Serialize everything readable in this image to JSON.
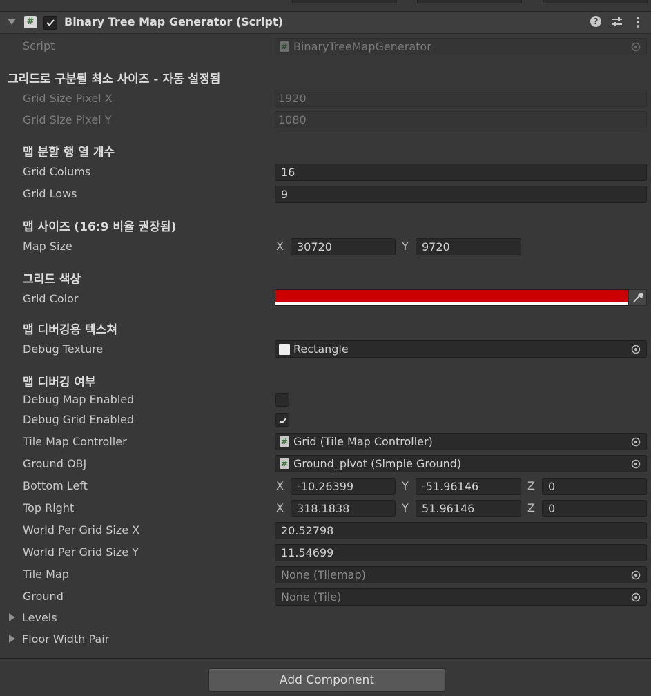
{
  "component": {
    "title": "Binary Tree Map Generator (Script)",
    "script_icon": "#",
    "help_glyph": "?",
    "enabled": true
  },
  "script": {
    "label": "Script",
    "value": "BinaryTreeMapGenerator"
  },
  "sections": {
    "grid_min": "그리드로 구분될 최소 사이즈 - 자동 설정됨",
    "split": "맵 분할 행 열 개수",
    "map_size": "맵 사이즈 (16:9 비율 권장됨)",
    "grid_color": "그리드 색상",
    "debug_texture": "맵 디버깅용 텍스쳐",
    "debug_enabled": "맵 디버깅 여부"
  },
  "fields": {
    "grid_size_pixel_x": {
      "label": "Grid Size Pixel X",
      "value": "1920"
    },
    "grid_size_pixel_y": {
      "label": "Grid Size Pixel Y",
      "value": "1080"
    },
    "grid_colums": {
      "label": "Grid Colums",
      "value": "16"
    },
    "grid_lows": {
      "label": "Grid Lows",
      "value": "9"
    },
    "map_size": {
      "label": "Map Size",
      "x": "30720",
      "y": "9720"
    },
    "grid_color": {
      "label": "Grid Color",
      "color": "#cc0000"
    },
    "debug_texture": {
      "label": "Debug Texture",
      "value": "Rectangle"
    },
    "debug_map_enabled": {
      "label": "Debug Map Enabled",
      "checked": false
    },
    "debug_grid_enabled": {
      "label": "Debug Grid Enabled",
      "checked": true
    },
    "tile_map_controller": {
      "label": "Tile Map Controller",
      "value": "Grid (Tile Map Controller)"
    },
    "ground_obj": {
      "label": "Ground OBJ",
      "value": "Ground_pivot (Simple Ground)"
    },
    "bottom_left": {
      "label": "Bottom Left",
      "x": "-10.26399",
      "y": "-51.96146",
      "z": "0"
    },
    "top_right": {
      "label": "Top Right",
      "x": "318.1838",
      "y": "51.96146",
      "z": "0"
    },
    "world_per_grid_size_x": {
      "label": "World Per Grid Size X",
      "value": "20.52798"
    },
    "world_per_grid_size_y": {
      "label": "World Per Grid Size Y",
      "value": "11.54699"
    },
    "tile_map": {
      "label": "Tile Map",
      "value": "None (Tilemap)"
    },
    "ground": {
      "label": "Ground",
      "value": "None (Tile)"
    }
  },
  "axes": {
    "x": "X",
    "y": "Y",
    "z": "Z"
  },
  "foldouts": {
    "levels": "Levels",
    "floor_width_pair": "Floor Width Pair"
  },
  "add_component": "Add Component"
}
